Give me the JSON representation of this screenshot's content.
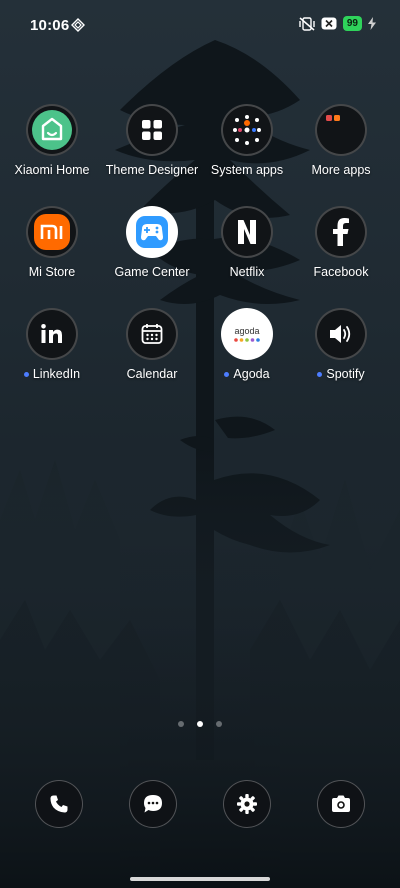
{
  "status_bar": {
    "time": "10:06",
    "battery_level": "99",
    "icons": [
      "data-saver-icon",
      "mute-vibrate-icon",
      "close-box-icon",
      "charging-bolt-icon"
    ]
  },
  "apps": [
    {
      "label": "Xiaomi Home",
      "icon": "xiaomi-home-icon",
      "new_dot": false
    },
    {
      "label": "Theme Designer",
      "icon": "grid-squares-icon",
      "new_dot": false
    },
    {
      "label": "System apps",
      "icon": "folder-icon",
      "new_dot": false
    },
    {
      "label": "More apps",
      "icon": "folder-icon",
      "new_dot": false
    },
    {
      "label": "Mi Store",
      "icon": "mi-store-icon",
      "new_dot": false
    },
    {
      "label": "Game Center",
      "icon": "gamepad-icon",
      "new_dot": false
    },
    {
      "label": "Netflix",
      "icon": "netflix-n-icon",
      "new_dot": false
    },
    {
      "label": "Facebook",
      "icon": "facebook-f-icon",
      "new_dot": false
    },
    {
      "label": "LinkedIn",
      "icon": "linkedin-in-icon",
      "new_dot": true
    },
    {
      "label": "Calendar",
      "icon": "calendar-icon",
      "new_dot": false
    },
    {
      "label": "Agoda",
      "icon": "agoda-logo-icon",
      "new_dot": true
    },
    {
      "label": "Spotify",
      "icon": "speaker-icon",
      "new_dot": true
    }
  ],
  "agoda_logo_text": "agoda",
  "pager": {
    "pages": 3,
    "active": 2
  },
  "dock": [
    {
      "name": "phone",
      "icon": "phone-icon"
    },
    {
      "name": "messages",
      "icon": "chat-bubble-icon"
    },
    {
      "name": "settings",
      "icon": "gear-icon"
    },
    {
      "name": "camera",
      "icon": "camera-icon"
    }
  ],
  "colors": {
    "battery": "#2fd35b",
    "xiaomi_home_green": "#4cc38a",
    "mi_store_orange": "#ff6a00",
    "game_center_blue": "#2f9bff",
    "new_dot": "#4d7dff"
  }
}
